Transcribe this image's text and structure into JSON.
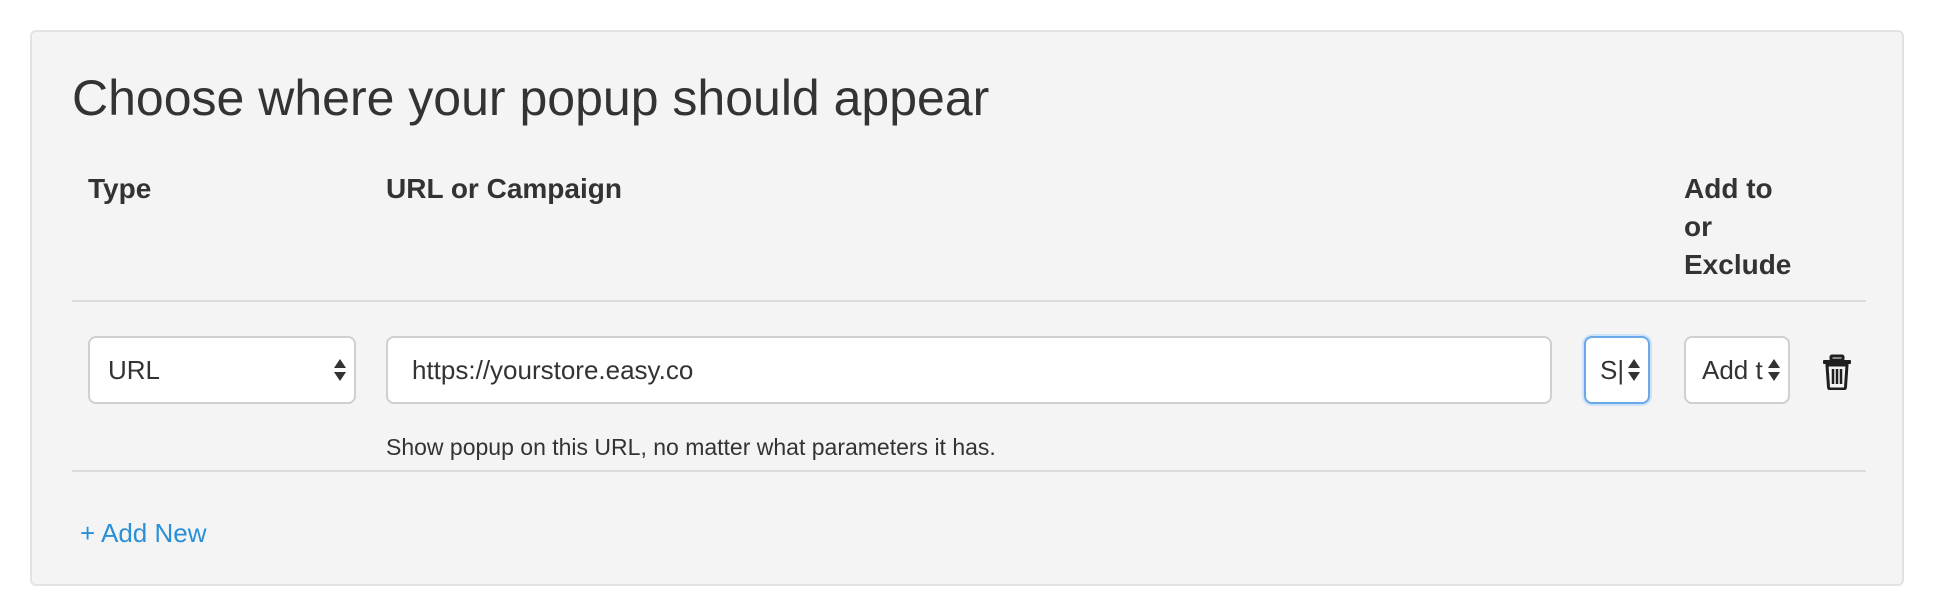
{
  "panel": {
    "title": "Choose where your popup should appear"
  },
  "columns": {
    "type": "Type",
    "url_or_campaign": "URL or Campaign",
    "add_or_exclude": "Add to or Exclude"
  },
  "rows": [
    {
      "type_value": "URL",
      "url_value": "https://yourstore.easy.co",
      "match_value": "S|",
      "add_exclude_value": "Add t",
      "helper_text": "Show popup on this URL, no matter what parameters it has."
    }
  ],
  "actions": {
    "add_new_label": "+ Add New"
  },
  "icons": {
    "delete": "trash-icon",
    "select_arrows": "updown-arrows-icon"
  },
  "colors": {
    "panel_bg": "#f4f4f4",
    "link": "#2b8fd6",
    "focus_border": "#6aa9e8"
  }
}
